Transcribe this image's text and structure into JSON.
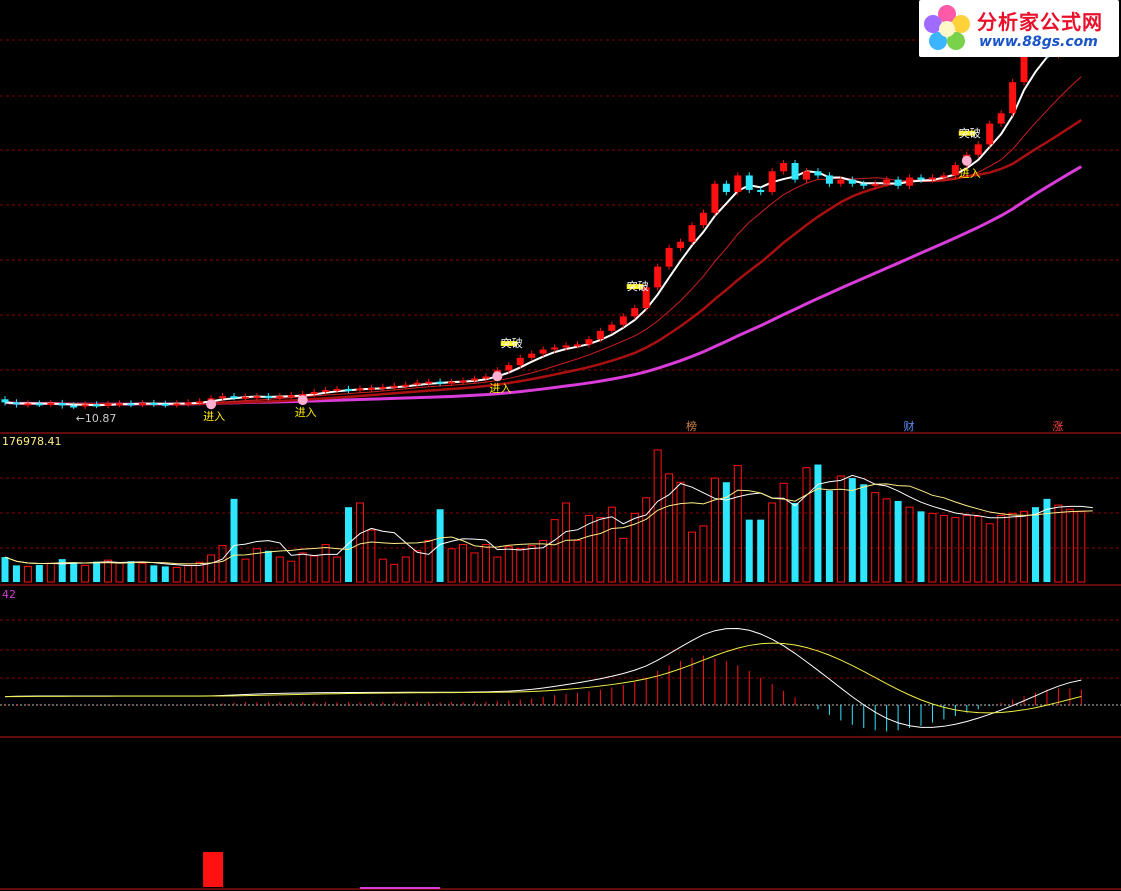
{
  "watermark": {
    "name": "分析家公式网",
    "url": "www.88gs.com"
  },
  "colors": {
    "background": "#000000",
    "grid": "#8b0000",
    "up": "#ff1111",
    "down": "#2fe6ff",
    "highlight": "#ffee00",
    "white_line": "#ffffff",
    "magenta_line": "#d93cd9",
    "volume_ma": "#ffee88",
    "macd_dif": "#ffffff",
    "macd_dea": "#eeee44"
  },
  "price_panel": {
    "min_marker_label": "←10.87",
    "signals": [
      {
        "text": "进入",
        "index": 18
      },
      {
        "text": "进入",
        "index": 26
      },
      {
        "text": "进入",
        "index": 43
      },
      {
        "text": "突破",
        "index": 44
      },
      {
        "text": "突破",
        "index": 55
      },
      {
        "text": "突破",
        "index": 84
      },
      {
        "text": "进入",
        "index": 84
      }
    ],
    "bottom_tags": [
      {
        "text": "榜",
        "index": 60,
        "color": "#d08040"
      },
      {
        "text": "财",
        "index": 79,
        "color": "#6090ff"
      },
      {
        "text": "涨",
        "index": 92,
        "color": "#ff4444"
      }
    ]
  },
  "volume_panel": {
    "value_label": "176978.41"
  },
  "macd_panel": {
    "value_label": "42"
  },
  "chart_data": {
    "type": "candlestick",
    "series": [
      {
        "name": "price",
        "open": [
          11.2,
          11.05,
          10.95,
          11.0,
          10.98,
          11.02,
          10.9,
          10.88,
          10.95,
          10.92,
          10.98,
          11.0,
          10.97,
          11.02,
          10.98,
          10.95,
          11.0,
          11.05,
          11.1,
          11.25,
          11.35,
          11.3,
          11.32,
          11.35,
          11.3,
          11.35,
          11.4,
          11.45,
          11.55,
          11.65,
          11.7,
          11.65,
          11.72,
          11.75,
          11.8,
          11.85,
          11.9,
          12.0,
          12.05,
          12.0,
          12.05,
          12.1,
          12.2,
          12.3,
          12.6,
          12.85,
          13.2,
          13.4,
          13.6,
          13.7,
          13.8,
          13.85,
          14.1,
          14.5,
          14.8,
          15.2,
          15.6,
          16.6,
          17.6,
          18.5,
          18.8,
          19.6,
          20.2,
          21.6,
          21.2,
          22.0,
          21.3,
          21.2,
          22.2,
          22.6,
          21.8,
          22.2,
          22.0,
          21.6,
          21.8,
          21.6,
          21.5,
          21.6,
          21.8,
          21.5,
          21.9,
          21.8,
          21.9,
          22.0,
          22.5,
          23.0,
          23.5,
          24.5,
          25.0,
          26.5,
          28.5,
          28.0,
          27.8,
          27.9,
          27.9
        ],
        "close": [
          11.05,
          10.95,
          11.0,
          10.98,
          11.02,
          10.9,
          10.88,
          10.95,
          10.92,
          10.98,
          11.0,
          10.97,
          11.02,
          10.98,
          10.95,
          11.0,
          11.05,
          11.1,
          11.25,
          11.35,
          11.3,
          11.32,
          11.35,
          11.3,
          11.35,
          11.4,
          11.45,
          11.55,
          11.65,
          11.7,
          11.65,
          11.72,
          11.75,
          11.8,
          11.85,
          11.9,
          12.0,
          12.05,
          12.0,
          12.05,
          12.1,
          12.2,
          12.3,
          12.6,
          12.85,
          13.2,
          13.4,
          13.6,
          13.7,
          13.8,
          13.85,
          14.1,
          14.5,
          14.8,
          15.2,
          15.6,
          16.6,
          17.6,
          18.5,
          18.8,
          19.6,
          20.2,
          21.6,
          21.2,
          22.0,
          21.3,
          21.2,
          22.2,
          22.6,
          21.8,
          22.2,
          22.0,
          21.6,
          21.8,
          21.6,
          21.5,
          21.6,
          21.8,
          21.5,
          21.9,
          21.8,
          21.9,
          22.0,
          22.5,
          23.0,
          23.5,
          24.5,
          25.0,
          26.5,
          28.5,
          28.0,
          27.8,
          27.9,
          27.9,
          28.1
        ],
        "min": 10.87,
        "max": 28.5
      },
      {
        "name": "volume",
        "values": [
          12000,
          8000,
          7500,
          8200,
          9000,
          11000,
          9500,
          8000,
          9800,
          10500,
          9200,
          10000,
          9000,
          8000,
          7500,
          7000,
          8000,
          9500,
          13000,
          17500,
          40000,
          11000,
          16000,
          15000,
          12000,
          10000,
          14000,
          12500,
          18000,
          12000,
          36000,
          38000,
          25000,
          11000,
          8500,
          12000,
          15000,
          20000,
          35000,
          16000,
          18000,
          14000,
          18000,
          12000,
          17000,
          16000,
          17500,
          20000,
          30000,
          38000,
          20000,
          32000,
          31000,
          36000,
          21000,
          33000,
          40500,
          63500,
          52000,
          48000,
          24000,
          27000,
          50000,
          48000,
          56000,
          30000,
          30000,
          38000,
          47500,
          38000,
          55000,
          56500,
          44000,
          51000,
          50000,
          47000,
          43000,
          40000,
          39000,
          36000,
          34000,
          33000,
          32000,
          31000,
          32000,
          31500,
          28000,
          32000,
          33000,
          34000,
          36000,
          40000,
          37000,
          35000,
          34000,
          33000
        ]
      },
      {
        "name": "macd_hist",
        "values": [
          0.02,
          0.02,
          0.02,
          0.01,
          0.01,
          0.01,
          0.01,
          0.01,
          0.01,
          0.01,
          0.01,
          0.01,
          0.01,
          0.01,
          0.01,
          0.01,
          0.01,
          0.01,
          0.02,
          0.03,
          0.04,
          0.05,
          0.05,
          0.05,
          0.05,
          0.05,
          0.05,
          0.05,
          0.05,
          0.05,
          0.05,
          0.05,
          0.05,
          0.05,
          0.05,
          0.05,
          0.05,
          0.05,
          0.05,
          0.05,
          0.05,
          0.06,
          0.06,
          0.07,
          0.08,
          0.1,
          0.12,
          0.15,
          0.18,
          0.2,
          0.22,
          0.25,
          0.28,
          0.32,
          0.36,
          0.42,
          0.5,
          0.62,
          0.72,
          0.8,
          0.86,
          0.9,
          0.85,
          0.8,
          0.72,
          0.62,
          0.5,
          0.38,
          0.26,
          0.14,
          0.02,
          -0.08,
          -0.18,
          -0.28,
          -0.36,
          -0.42,
          -0.46,
          -0.48,
          -0.46,
          -0.42,
          -0.38,
          -0.32,
          -0.26,
          -0.2,
          -0.14,
          -0.08,
          -0.02,
          0.04,
          0.1,
          0.16,
          0.22,
          0.28,
          0.3,
          0.3,
          0.28
        ]
      }
    ],
    "ma_white": "short moving average",
    "ma_red": "medium moving average",
    "ma_magenta": "long moving average"
  }
}
